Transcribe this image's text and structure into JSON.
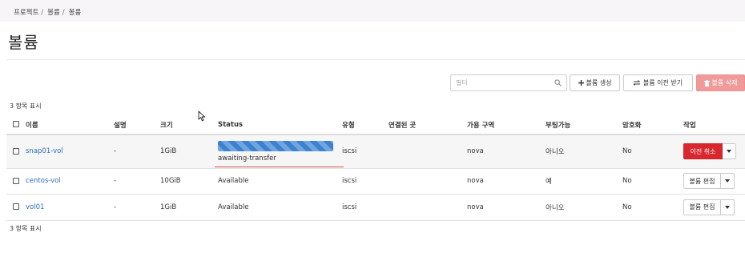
{
  "breadcrumb": [
    "프로젝트",
    "볼륨",
    "볼륨"
  ],
  "page": {
    "title": "볼륨"
  },
  "filter": {
    "placeholder": "필터",
    "value": ""
  },
  "toolbar": {
    "create_label": "볼륨 생성",
    "transfer_label": "볼륨 이전 받기",
    "delete_label": "볼륨 삭제"
  },
  "count_label": "3 항목 표시",
  "table": {
    "headers": {
      "name": "이름",
      "description": "설명",
      "size": "크기",
      "status": "Status",
      "type": "유형",
      "attached_to": "연결된 곳",
      "availability_zone": "가용 구역",
      "bootable": "부팅가능",
      "encrypted": "암호화",
      "actions": "작업"
    },
    "rows": [
      {
        "name": "snap01-vol",
        "description": "-",
        "size": "1GiB",
        "status": "awaiting-transfer",
        "progress": 1.0,
        "type": "iscsi",
        "attached_to": "",
        "availability_zone": "nova",
        "bootable": "아니오",
        "encrypted": "No",
        "action": "이전 취소"
      },
      {
        "name": "centos-vol",
        "description": "-",
        "size": "10GiB",
        "status": "Available",
        "type": "iscsi",
        "attached_to": "",
        "availability_zone": "nova",
        "bootable": "예",
        "encrypted": "No",
        "action": "볼륨 편집"
      },
      {
        "name": "vol01",
        "description": "-",
        "size": "1GiB",
        "status": "Available",
        "type": "iscsi",
        "attached_to": "",
        "availability_zone": "nova",
        "bootable": "아니오",
        "encrypted": "No",
        "action": "볼륨 편집"
      }
    ]
  },
  "colors": {
    "link": "#2e6fb7",
    "danger": "#d9272e",
    "delete_button": "#f09a9a",
    "progress": "#3b82d0"
  },
  "icons": [
    "search-icon",
    "plus-icon",
    "transfer-icon",
    "trash-icon",
    "caret-down-icon",
    "mouse-cursor-icon"
  ]
}
